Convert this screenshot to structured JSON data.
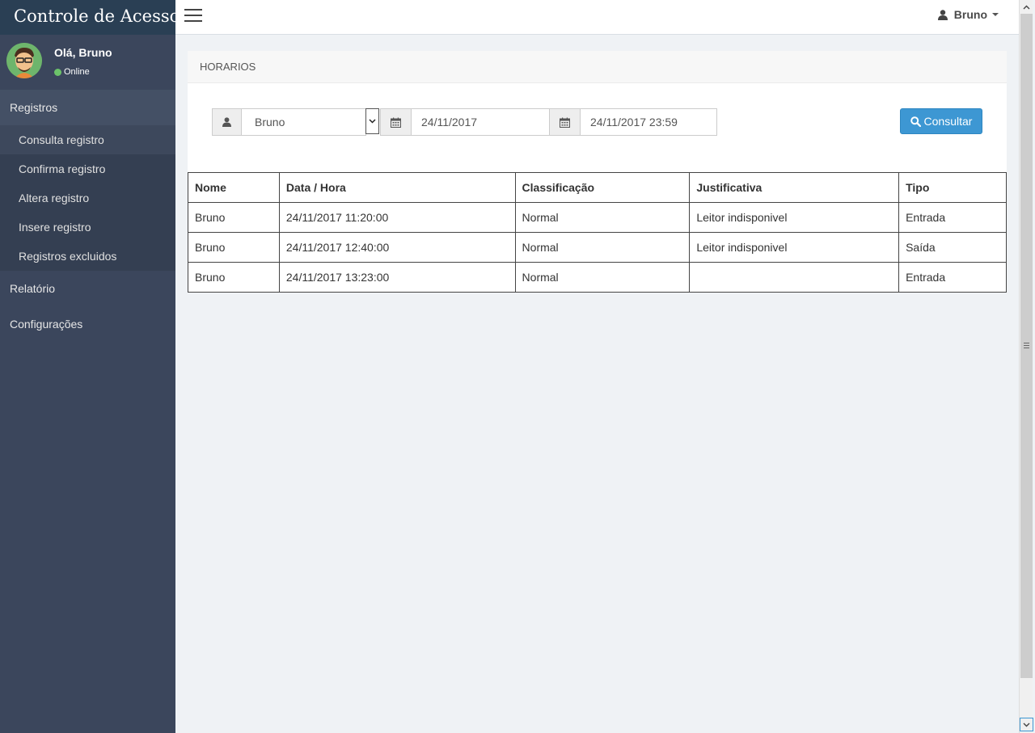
{
  "app": {
    "title": "Controle de Acesso"
  },
  "profile": {
    "greeting": "Olá, Bruno",
    "status": "Online",
    "status_color": "#6cc36a"
  },
  "sidebar": {
    "sections": [
      {
        "label": "Registros",
        "items": [
          "Consulta registro",
          "Confirma registro",
          "Altera registro",
          "Insere registro",
          "Registros excluidos"
        ]
      },
      {
        "label": "Relatório"
      },
      {
        "label": "Configurações"
      }
    ]
  },
  "topbar": {
    "user": "Bruno"
  },
  "panel": {
    "title": "HORARIOS"
  },
  "filters": {
    "user_select": "Bruno",
    "start_date": "24/11/2017",
    "end_date": "24/11/2017 23:59",
    "submit_label": "Consultar"
  },
  "table": {
    "headers": [
      "Nome",
      "Data / Hora",
      "Classificação",
      "Justificativa",
      "Tipo"
    ],
    "rows": [
      [
        "Bruno",
        "24/11/2017 11:20:00",
        "Normal",
        "Leitor indisponivel",
        "Entrada"
      ],
      [
        "Bruno",
        "24/11/2017 12:40:00",
        "Normal",
        "Leitor indisponivel",
        "Saída"
      ],
      [
        "Bruno",
        "24/11/2017 13:23:00",
        "Normal",
        "",
        "Entrada"
      ]
    ]
  },
  "colors": {
    "sidebar": "#3b465c",
    "brand": "#2a3f54",
    "primary_button": "#3d97d3"
  },
  "icons": [
    "menu-icon",
    "user-icon",
    "calendar-icon",
    "search-icon",
    "caret-down-icon"
  ]
}
